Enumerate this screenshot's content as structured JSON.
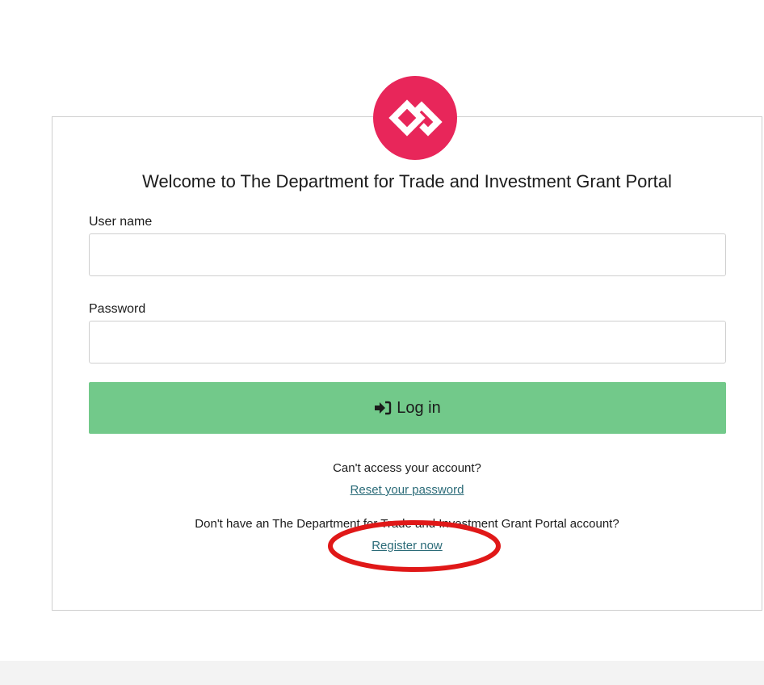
{
  "page": {
    "title": "Welcome to The Department for Trade and Investment Grant Portal"
  },
  "logo": {
    "icon": "brand-logo-icon",
    "color": "#e8265a"
  },
  "form": {
    "username_label": "User name",
    "username_value": "",
    "password_label": "Password",
    "password_value": "",
    "login_button_label": "Log in",
    "login_icon": "sign-in-icon",
    "login_button_color": "#72c98a"
  },
  "help": {
    "cant_access_text": "Can't access your account?",
    "reset_link_label": "Reset your password",
    "no_account_text": "Don't have an The Department for Trade and Investment Grant Portal account?",
    "register_link_label": "Register now",
    "link_color": "#2b6b78"
  },
  "annotation": {
    "shape": "ellipse",
    "color": "#e01818",
    "target": "register-link"
  }
}
